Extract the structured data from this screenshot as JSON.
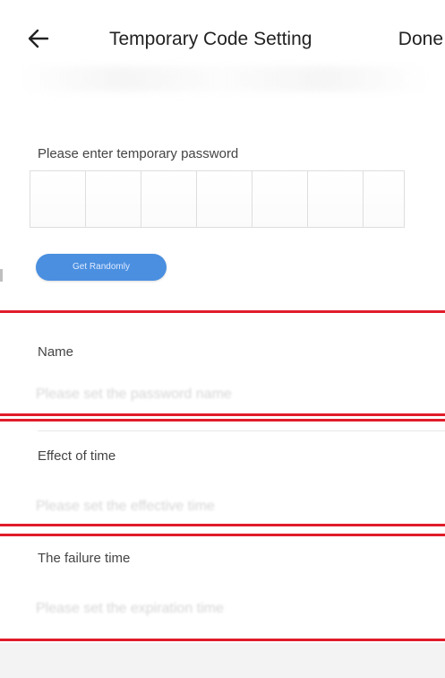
{
  "header": {
    "title": "Temporary Code Setting",
    "done_label": "Done",
    "back_icon": "arrow-left-icon"
  },
  "password": {
    "prompt": "Please enter temporary password",
    "box_count": 7,
    "random_button_label": "Get Randomly"
  },
  "fields": {
    "name": {
      "label": "Name",
      "placeholder": "Please set the password name"
    },
    "effect_time": {
      "label": "Effect of time",
      "placeholder": "Please set the effective time"
    },
    "failure_time": {
      "label": "The failure time",
      "placeholder": "Please set the expiration time"
    }
  },
  "colors": {
    "accent": "#4a8fe0",
    "highlight": "#e01c2a"
  }
}
